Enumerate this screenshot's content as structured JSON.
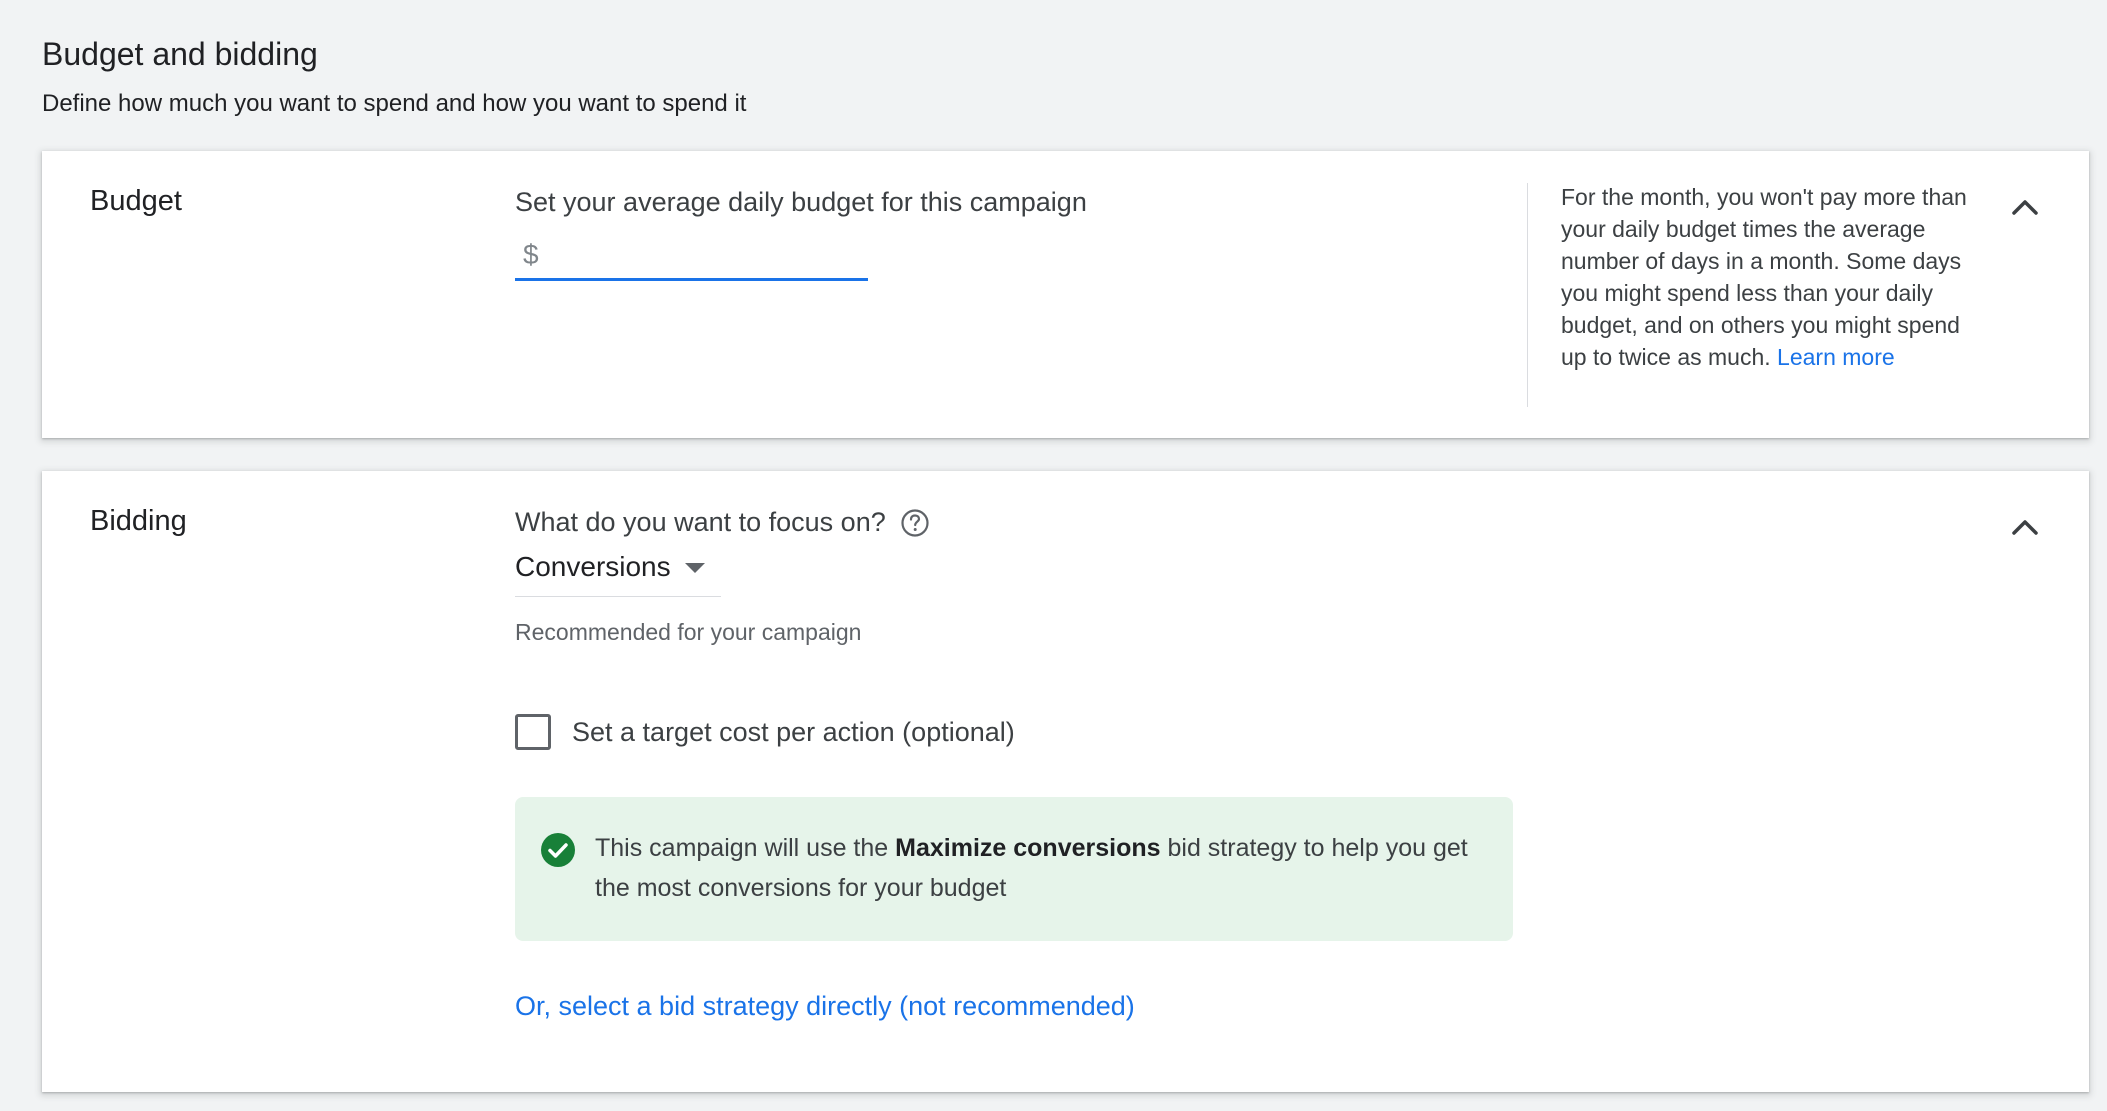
{
  "section": {
    "title": "Budget and bidding",
    "subtitle": "Define how much you want to spend and how you want to spend it"
  },
  "budget": {
    "label": "Budget",
    "prompt": "Set your average daily budget for this campaign",
    "currency": "$",
    "value": "",
    "help_text": "For the month, you won't pay more than your daily budget times the average number of days in a month. Some days you might spend less than your daily budget, and on others you might spend up to twice as much.",
    "help_link": "Learn more"
  },
  "bidding": {
    "label": "Bidding",
    "focus_question": "What do you want to focus on?",
    "focus_value": "Conversions",
    "recommended": "Recommended for your campaign",
    "checkbox_label": "Set a target cost per action (optional)",
    "checkbox_checked": false,
    "info_prefix": "This campaign will use the",
    "info_strategy": "Maximize conversions",
    "info_suffix": "bid strategy to help you get the most conversions for your budget",
    "direct_link": "Or, select a bid strategy directly (not recommended)"
  },
  "icons": {
    "collapse": "chevron-up-icon",
    "help": "help-circle-icon",
    "dropdown": "dropdown-arrow-icon",
    "success": "check-circle-icon"
  },
  "colors": {
    "accent": "#1a73e8",
    "success": "#188038",
    "success_bg": "#e6f4ea",
    "page_bg": "#f1f3f4"
  }
}
